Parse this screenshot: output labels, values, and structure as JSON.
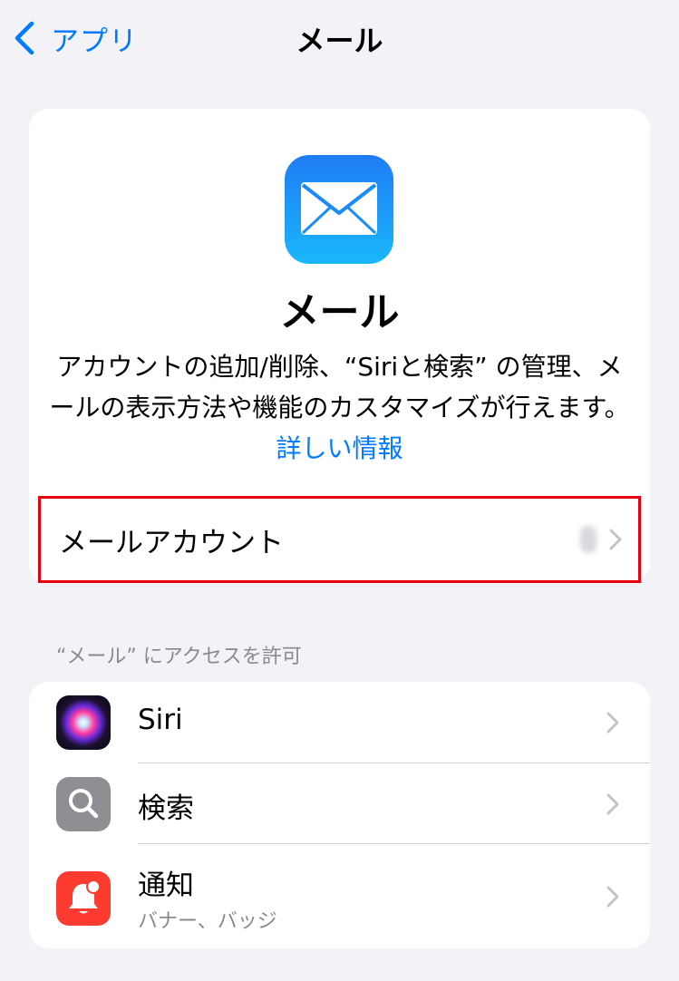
{
  "nav": {
    "back_label": "アプリ",
    "title": "メール"
  },
  "app_card": {
    "app_name": "メール",
    "description": "アカウントの追加/削除、“Siriと検索” の管理、メールの表示方法や機能のカスタマイズが行えます。",
    "learn_more_link": "詳しい情報",
    "account_row_label": "メールアカウント",
    "icon": "mail-envelope-icon"
  },
  "access_section": {
    "header": "“メール” にアクセスを許可",
    "items": [
      {
        "label": "Siri",
        "icon": "siri-icon"
      },
      {
        "label": "検索",
        "icon": "search-icon"
      },
      {
        "label": "通知",
        "sublabel": "バナー、バッジ",
        "icon": "notification-bell-icon"
      }
    ]
  },
  "colors": {
    "accent": "#007aff",
    "highlight_border": "#e5000f",
    "background": "#f2f2f7",
    "notification_red": "#fe3b30",
    "search_gray": "#8e8e93"
  }
}
